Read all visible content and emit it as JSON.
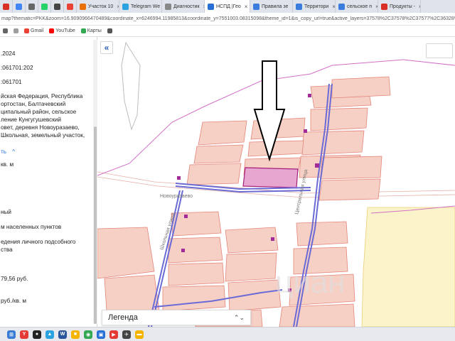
{
  "browser": {
    "tabs": [
      {
        "label": "",
        "color": "#d93025"
      },
      {
        "label": "",
        "color": "#4285f4"
      },
      {
        "label": "",
        "color": "#666666"
      },
      {
        "label": "",
        "color": "#25d366"
      },
      {
        "label": "",
        "color": "#444444"
      },
      {
        "label": "",
        "color": "#ea4335"
      },
      {
        "label": "Участок 10",
        "color": "#e8710a"
      },
      {
        "label": "Telegram We",
        "color": "#2aa3e0"
      },
      {
        "label": "Диагностик",
        "color": "#888888"
      },
      {
        "label": "НСПД |Гео",
        "color": "#2a6fd6",
        "active": true
      },
      {
        "label": "Правила зе",
        "color": "#3b7ddd"
      },
      {
        "label": "Территори",
        "color": "#3b7ddd"
      },
      {
        "label": "сельское п",
        "color": "#3b7ddd"
      },
      {
        "label": "Продукты -",
        "color": "#d93025"
      }
    ],
    "url": "map?thematic=PKK&zoom=16.9090966470489&coordinate_x=6246994.11985813&coordinate_y=7551003.08315098&theme_id=1&is_copy_url=true&active_layers=37578%2C37578%2C37577%2C36328%2C36049%2C36048",
    "bookmarks": [
      {
        "label": "",
        "color": "#666666"
      },
      {
        "label": "",
        "color": "#9e9e9e"
      },
      {
        "label": "Gmail",
        "color": "#ea4335"
      },
      {
        "label": "YouTube",
        "color": "#ff0000"
      },
      {
        "label": "Карты",
        "color": "#34a853"
      },
      {
        "label": "",
        "color": "#555555"
      }
    ]
  },
  "panel": {
    "date": ".2024",
    "cadastral_1": ":061701:202",
    "cadastral_2": ":061701",
    "address_lines": [
      "йская Федерация, Республика",
      "ортостан, Балтачевский",
      "ципальный район, сельское",
      "ление Кунгугушевский",
      "овет, деревня Новоуразаево,",
      "Школьная, земельный участок,"
    ],
    "show_more": "ть",
    "show_more_arrow": "^",
    "area_unit": "кв. м",
    "category_tail": "ный",
    "category_line": "м населенных пунктов",
    "use_line_1": "едения личного подсобного",
    "use_line_2": "ства",
    "cost": "79,56 руб.",
    "cost_per_unit": "руб./кв. м"
  },
  "map": {
    "collapse_icon": "«",
    "street_labels": [
      "Новоуразаево",
      "Школьная улица",
      "Центральная улица"
    ],
    "watermark": "циан",
    "colors": {
      "parcel_fill": "#f6cfc5",
      "parcel_stroke": "#e3867a",
      "selected_fill": "#e7a6d0",
      "selected_stroke": "#a51f7a",
      "road_line": "#6b6bd6",
      "zone_line": "#d36fc6",
      "yellow_zone": "#fbf3c9"
    },
    "legend_label": "Легенда",
    "legend_arrows": "⌃⌄"
  },
  "taskbar": {
    "icons": [
      {
        "name": "windows",
        "color": "#3a7bd5",
        "glyph": "⊞"
      },
      {
        "name": "yandex",
        "color": "#e53935",
        "glyph": "Y"
      },
      {
        "name": "app-2",
        "color": "#222222",
        "glyph": "●"
      },
      {
        "name": "app-3",
        "color": "#2aa3e0",
        "glyph": "▲"
      },
      {
        "name": "app-4",
        "color": "#2b579a",
        "glyph": "W"
      },
      {
        "name": "app-5",
        "color": "#f4b400",
        "glyph": "■"
      },
      {
        "name": "chrome",
        "color": "#34a853",
        "glyph": "◉"
      },
      {
        "name": "app-7",
        "color": "#2a6fd6",
        "glyph": "▣"
      },
      {
        "name": "app-8",
        "color": "#e53935",
        "glyph": "▶"
      },
      {
        "name": "app-9",
        "color": "#444444",
        "glyph": "✈"
      },
      {
        "name": "app-10",
        "color": "#f4b400",
        "glyph": "▬"
      }
    ]
  }
}
